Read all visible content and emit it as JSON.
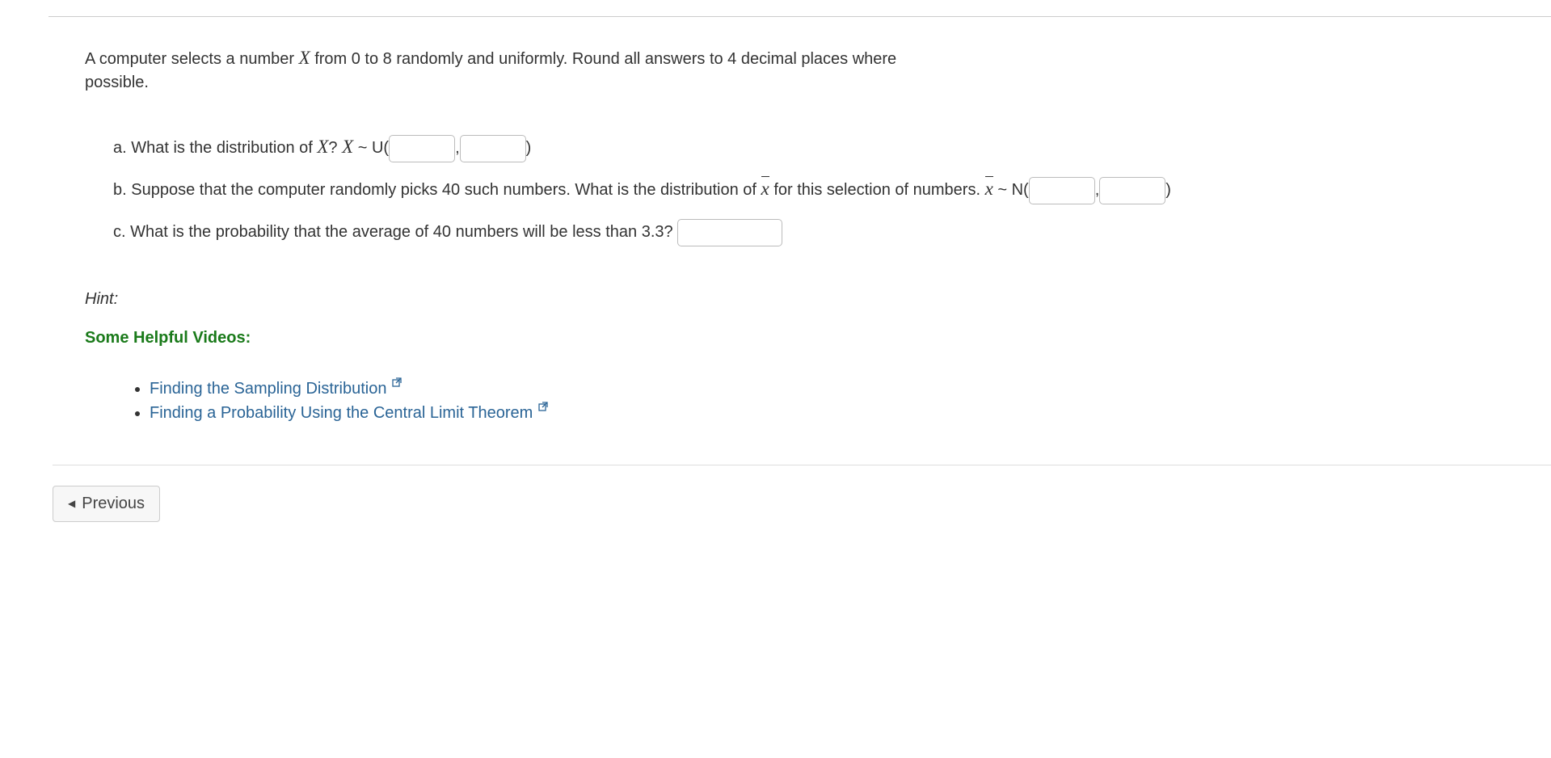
{
  "intro": {
    "text_before_X": "A computer selects a number ",
    "X": "X",
    "text_after_X": " from 0 to 8 randomly and uniformly. Round all answers to 4 decimal places where possible."
  },
  "questions": {
    "a": {
      "label": "a.",
      "text1": "What is the distribution of ",
      "X": "X",
      "text2": "? ",
      "X2": "X",
      "tilde_U": " ~ U(",
      "comma": ",",
      "close": ")"
    },
    "b": {
      "label": "b.",
      "text1": "Suppose that the computer randomly picks 40 such numbers.  What is the distribution of ",
      "xbar": "x",
      "text2": " for this selection of numbers. ",
      "xbar2": "x",
      "tilde_N": " ~ N(",
      "comma": ",",
      "close": ")"
    },
    "c": {
      "label": "c.",
      "text1": "What is the probability that the average of 40 numbers will be less than 3.3? "
    }
  },
  "hint": {
    "label": "Hint:",
    "videos_header": "Some Helpful Videos:",
    "videos": [
      "Finding the Sampling Distribution",
      "Finding a Probability Using the Central Limit Theorem"
    ]
  },
  "nav": {
    "previous": "Previous"
  }
}
